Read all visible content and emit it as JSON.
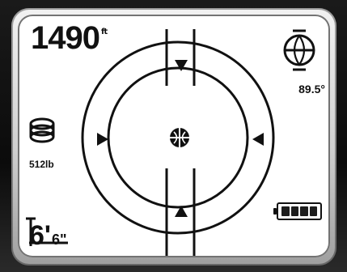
{
  "display": {
    "altitude_value": "1490",
    "altitude_unit_mark": "ft",
    "angle_value": "89.5°",
    "pressure_value": "512lb",
    "depth_feet": "6'",
    "depth_inches": "6\""
  },
  "icons": {
    "top_right": "globe-tilt-icon",
    "left_middle": "coil-icon",
    "center": "crosshair-globe-icon",
    "bottom_left": "depth-gauge-icon",
    "right": "battery-icon"
  },
  "battery": {
    "cells_filled": 4,
    "cells_total": 4
  },
  "colors": {
    "ink": "#111111",
    "screen": "#ffffff",
    "device": "#111111"
  }
}
